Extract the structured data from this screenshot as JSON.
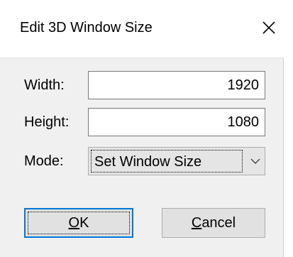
{
  "dialog": {
    "title": "Edit 3D Window Size",
    "close_glyph": "✕"
  },
  "width": {
    "label": "Width:",
    "value": "1920"
  },
  "height": {
    "label": "Height:",
    "value": "1080"
  },
  "mode": {
    "label": "Mode:",
    "selected": "Set Window Size"
  },
  "buttons": {
    "ok_mnemonic": "O",
    "ok_rest": "K",
    "cancel_mnemonic": "C",
    "cancel_rest": "ancel"
  },
  "icons": {
    "close": "close-icon",
    "dropdown": "chevron-down-icon"
  },
  "colors": {
    "accent": "#0078d7",
    "dialog_bg": "#f0f0f0",
    "titlebar_bg": "#ffffff"
  }
}
